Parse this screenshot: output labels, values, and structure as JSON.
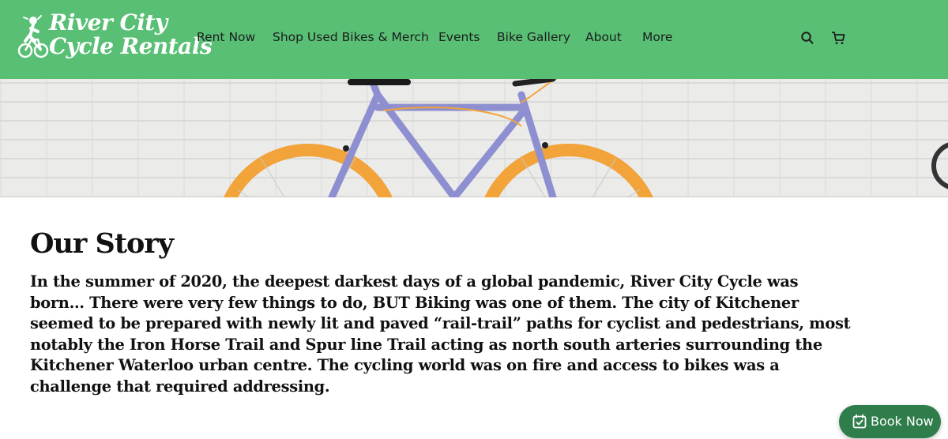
{
  "header": {
    "logo_line1": "River City",
    "logo_line2": "Cycle Rentals",
    "nav": [
      "Rent Now",
      "Shop Used Bikes & Merch",
      "Events",
      "Bike Gallery",
      "About",
      "More"
    ],
    "icons": [
      "search-icon",
      "cart-icon"
    ]
  },
  "hero": {
    "image": "orange-wheel-fixie-bike-against-white-brick-wall"
  },
  "story": {
    "title": "Our Story",
    "body": "In the summer of 2020, the deepest darkest days of a global pandemic, River City Cycle was born… There were very few things to do, BUT Biking was one of them. The city of Kitchener seemed to be prepared with newly lit and paved “rail-trail” paths for cyclist and pedestrians, most notably the Iron Horse Trail and Spur line Trail acting as north south arteries surrounding the Kitchener Waterloo urban centre. The cycling world was on fire and access to bikes was a challenge that required addressing."
  },
  "booking": {
    "label": "Book Now",
    "icon": "calendar-check-icon"
  },
  "colors": {
    "header_bg": "#58bf75",
    "button_bg": "#2f7d4a",
    "wheel": "#f2a33a",
    "frame": "#8d8fd0"
  }
}
